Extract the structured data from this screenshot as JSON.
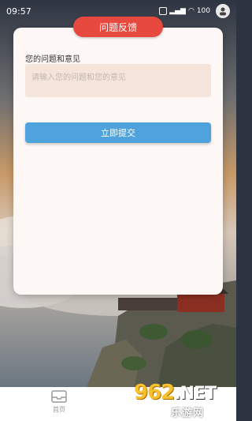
{
  "status_bar": {
    "time": "09:57",
    "battery": "100"
  },
  "feedback": {
    "title": "问题反馈",
    "field_label": "您的问题和意见",
    "placeholder": "请输入您的问题和您的意见",
    "submit_label": "立即提交"
  },
  "bottom_nav": {
    "home_label": "首页"
  },
  "watermark": {
    "brand": "962",
    "net": ".NET",
    "site": "乐游网"
  },
  "colors": {
    "title_badge": "#e8493e",
    "submit_button": "#4fa3dc",
    "card_background": "#fdf8f6",
    "textarea_background": "#f4e4da"
  }
}
